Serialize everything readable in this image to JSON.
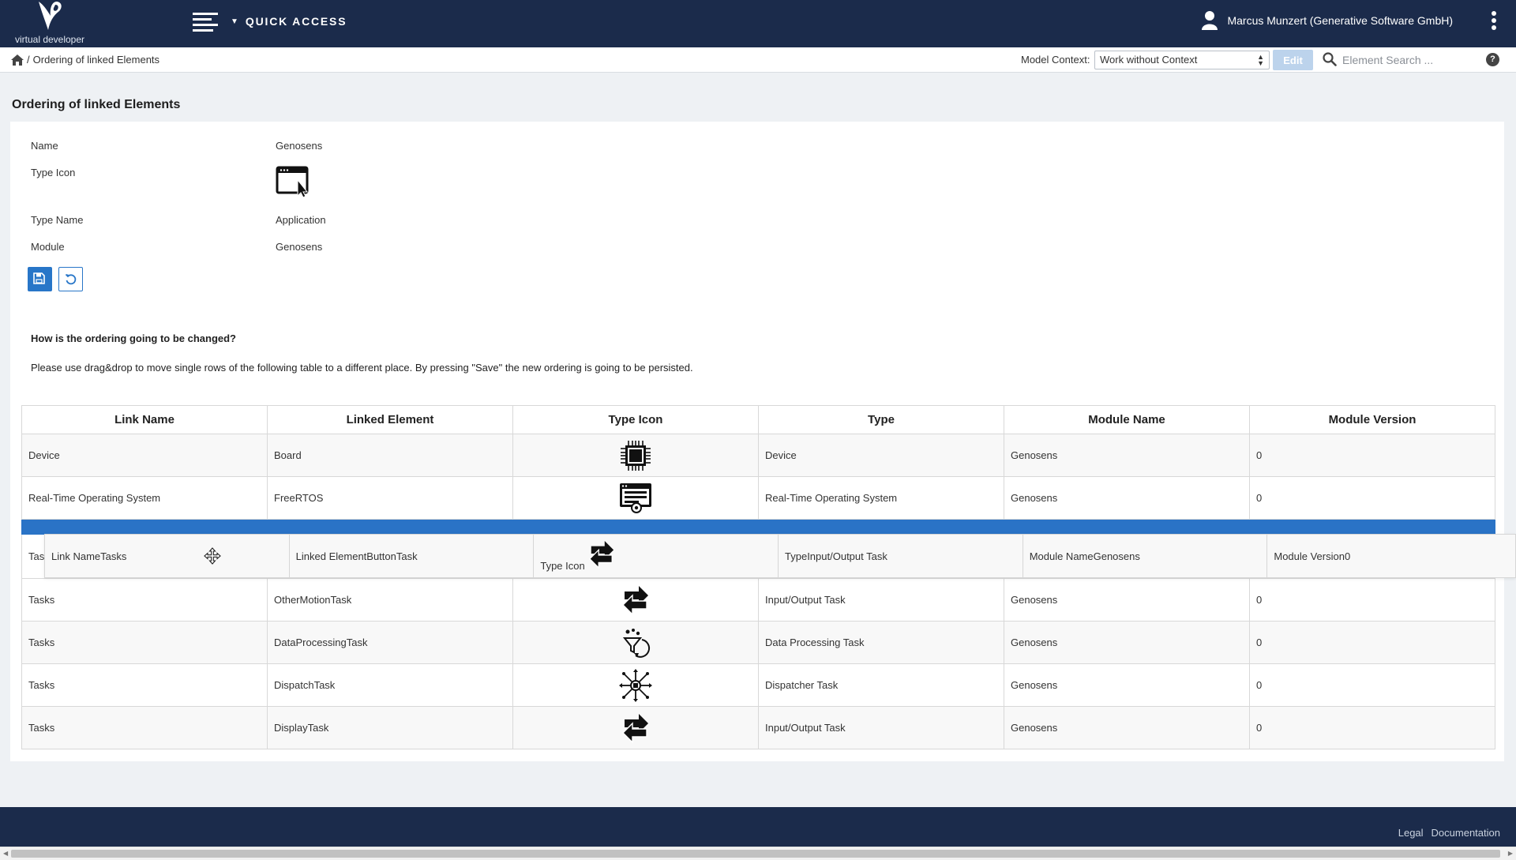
{
  "header": {
    "logo_text": "virtual developer",
    "quick_access": "QUICK ACCESS",
    "user_name": "Marcus Munzert (Generative Software GmbH)"
  },
  "subbar": {
    "breadcrumb_sep": "/",
    "breadcrumb_current": "Ordering of linked Elements",
    "model_context_label": "Model Context:",
    "model_context_value": "Work without Context",
    "edit_label": "Edit",
    "search_placeholder": "Element Search ..."
  },
  "page": {
    "title": "Ordering of linked Elements",
    "properties": {
      "name_label": "Name",
      "name_value": "Genosens",
      "type_icon_label": "Type Icon",
      "type_name_label": "Type Name",
      "type_name_value": "Application",
      "module_label": "Module",
      "module_value": "Genosens"
    },
    "help_title": "How is the ordering going to be changed?",
    "help_text": "Please use drag&drop to move single rows of the following table to a different place. By pressing \"Save\" the new ordering is going to be persisted."
  },
  "table": {
    "columns": [
      "Link Name",
      "Linked Element",
      "Type Icon",
      "Type",
      "Module Name",
      "Module Version"
    ],
    "rows": [
      {
        "link_name": "Device",
        "linked_element": "Board",
        "icon": "chip-icon",
        "type": "Device",
        "module": "Genosens",
        "version": "0"
      },
      {
        "link_name": "Real-Time Operating System",
        "linked_element": "FreeRTOS",
        "icon": "rtos-icon",
        "type": "Real-Time Operating System",
        "module": "Genosens",
        "version": "0"
      },
      {
        "link_name": "Tasks",
        "linked_element": "OtherMotionTask",
        "icon": "io-task-icon",
        "type": "Input/Output Task",
        "module": "Genosens",
        "version": "0"
      },
      {
        "link_name": "Tasks",
        "linked_element": "DataProcessingTask",
        "icon": "data-processing-icon",
        "type": "Data Processing Task",
        "module": "Genosens",
        "version": "0"
      },
      {
        "link_name": "Tasks",
        "linked_element": "DispatchTask",
        "icon": "dispatcher-icon",
        "type": "Dispatcher Task",
        "module": "Genosens",
        "version": "0"
      },
      {
        "link_name": "Tasks",
        "linked_element": "DisplayTask",
        "icon": "io-task-icon",
        "type": "Input/Output Task",
        "module": "Genosens",
        "version": "0"
      }
    ],
    "hidden_row_text": "Tasl",
    "dragged_row": {
      "link_name": "Link NameTasks",
      "linked_element": "Linked ElementButtonTask",
      "type_icon_label": "Type Icon",
      "icon": "io-task-icon",
      "type": "TypeInput/Output Task",
      "module": "Module NameGenosens",
      "version": "Module Version0"
    }
  },
  "footer": {
    "legal": "Legal",
    "documentation": "Documentation"
  }
}
